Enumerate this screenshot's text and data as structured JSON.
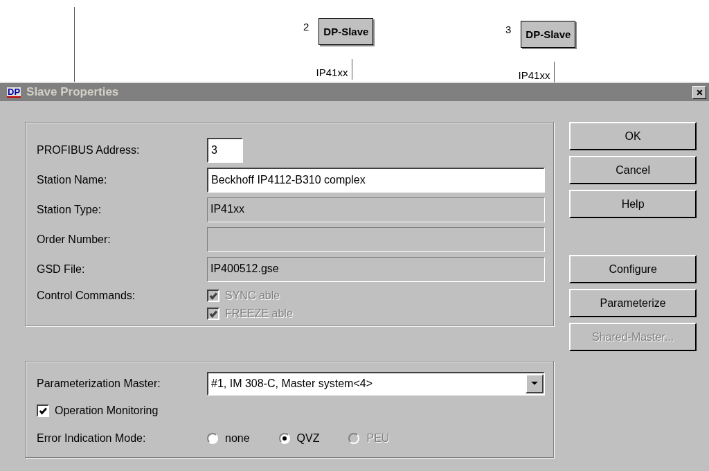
{
  "canvas": {
    "nodes": [
      {
        "number": "2",
        "label": "DP-Slave",
        "type_label": "IP41xx"
      },
      {
        "number": "3",
        "label": "DP-Slave",
        "type_label": "IP41xx"
      }
    ]
  },
  "dialog": {
    "title": "Slave Properties",
    "icon_text": "DP",
    "active": false,
    "fields": [
      {
        "kind": "short",
        "label": "PROFIBUS Address:",
        "value": "3",
        "disabled": false
      },
      {
        "kind": "text",
        "label": "Station Name:",
        "value": "Beckhoff IP4112-B310 complex",
        "disabled": false
      },
      {
        "kind": "text",
        "label": "Station Type:",
        "value": "IP41xx",
        "disabled": true
      },
      {
        "kind": "text",
        "label": "Order Number:",
        "disabled": true
      },
      {
        "kind": "text",
        "label": "GSD File:",
        "value": "IP400512.gse",
        "disabled": true
      },
      {
        "kind": "checks",
        "label": "Control Commands:",
        "options": [
          {
            "label": "SYNC able",
            "checked": true,
            "disabled": true
          },
          {
            "label": "FREEZE able",
            "checked": true,
            "disabled": true
          }
        ]
      }
    ],
    "master": {
      "label": "Parameterization Master:",
      "value": "#1, IM 308-C, Master system<4>"
    },
    "operation_monitoring": {
      "label": "Operation Monitoring",
      "checked": true
    },
    "error_mode": {
      "label": "Error Indication Mode:",
      "options": [
        {
          "label": "none",
          "selected": false,
          "disabled": false
        },
        {
          "label": "QVZ",
          "selected": true,
          "disabled": false
        },
        {
          "label": "PEU",
          "selected": false,
          "disabled": true
        }
      ]
    },
    "button_groups": [
      [
        {
          "label": "OK",
          "disabled": false
        },
        {
          "label": "Cancel",
          "disabled": false
        },
        {
          "label": "Help",
          "disabled": false
        }
      ],
      [
        {
          "label": "Configure",
          "disabled": false
        },
        {
          "label": "Parameterize",
          "disabled": false
        },
        {
          "label": "Shared-Master...",
          "disabled": true
        }
      ]
    ]
  }
}
